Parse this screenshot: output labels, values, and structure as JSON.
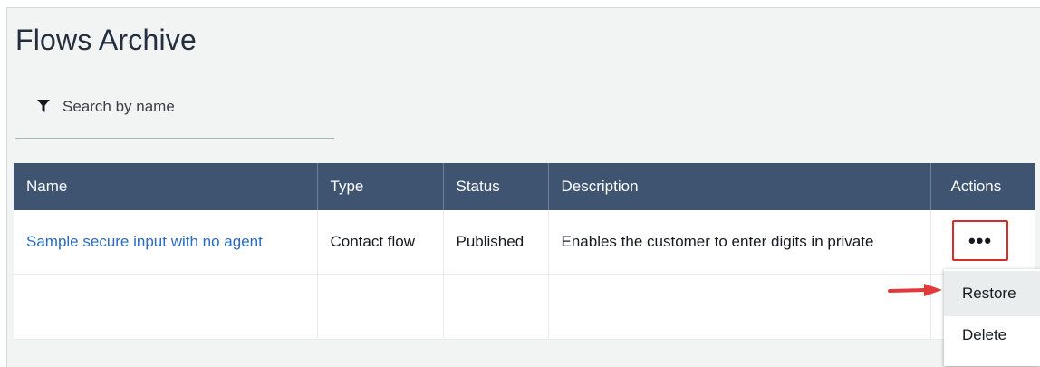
{
  "page": {
    "title": "Flows Archive"
  },
  "search": {
    "placeholder": "Search by name",
    "icon": "filter-icon"
  },
  "table": {
    "columns": [
      "Name",
      "Type",
      "Status",
      "Description",
      "Actions"
    ],
    "rows": [
      {
        "name": "Sample secure input with no agent",
        "type": "Contact flow",
        "status": "Published",
        "description": "Enables the customer to enter digits in private"
      }
    ]
  },
  "actions": {
    "button_label": "•••"
  },
  "menu": {
    "items": [
      "Restore",
      "Delete"
    ]
  },
  "colors": {
    "header_bg": "#3e5470",
    "link": "#2a6bbf",
    "highlight": "#d42b2b",
    "background": "#f2f3f3"
  }
}
